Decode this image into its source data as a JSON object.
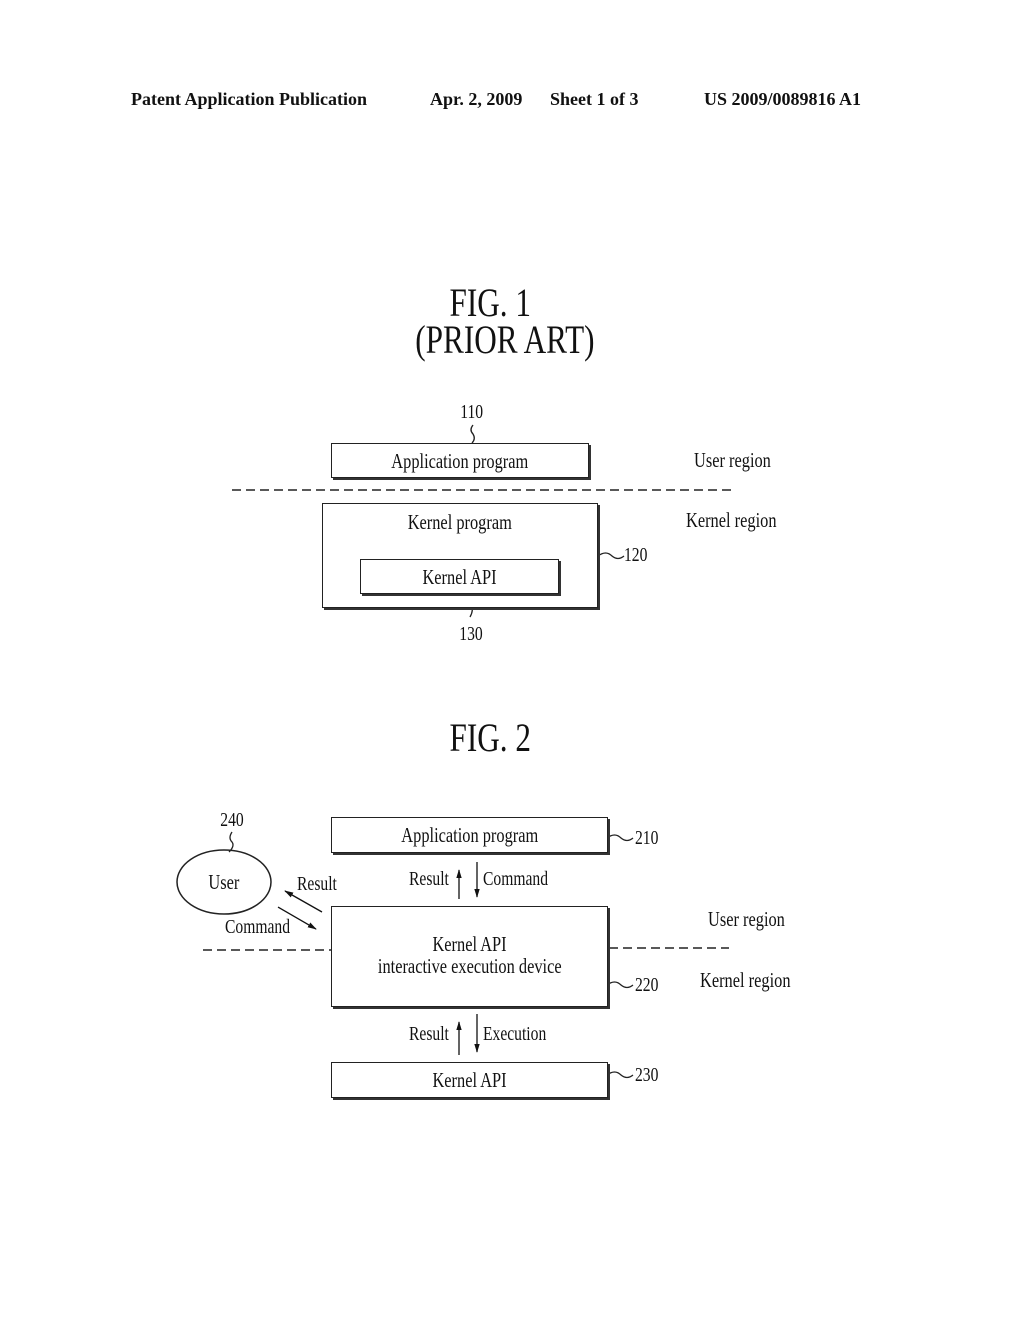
{
  "header": {
    "publication": "Patent Application Publication",
    "date": "Apr. 2, 2009",
    "sheet": "Sheet 1 of 3",
    "number": "US 2009/0089816 A1"
  },
  "fig1": {
    "title": "FIG. 1",
    "subtitle": "(PRIOR ART)",
    "app_box": {
      "label": "Application program",
      "ref": "110"
    },
    "kernel_box": {
      "label": "Kernel program",
      "ref": "120"
    },
    "kernel_api_box": {
      "label": "Kernel API",
      "ref": "130"
    },
    "user_region": "User region",
    "kernel_region": "Kernel region"
  },
  "fig2": {
    "title": "FIG. 2",
    "app_box": {
      "label": "Application program",
      "ref": "210"
    },
    "device_box": {
      "label_line1": "Kernel API",
      "label_line2": "interactive execution device",
      "ref": "220"
    },
    "kernel_api_box": {
      "label": "Kernel API",
      "ref": "230"
    },
    "user": {
      "label": "User",
      "ref": "240"
    },
    "arrows": {
      "app_result": "Result",
      "app_command": "Command",
      "user_result": "Result",
      "user_command": "Command",
      "api_result": "Result",
      "api_execution": "Execution"
    },
    "user_region": "User region",
    "kernel_region": "Kernel region"
  }
}
